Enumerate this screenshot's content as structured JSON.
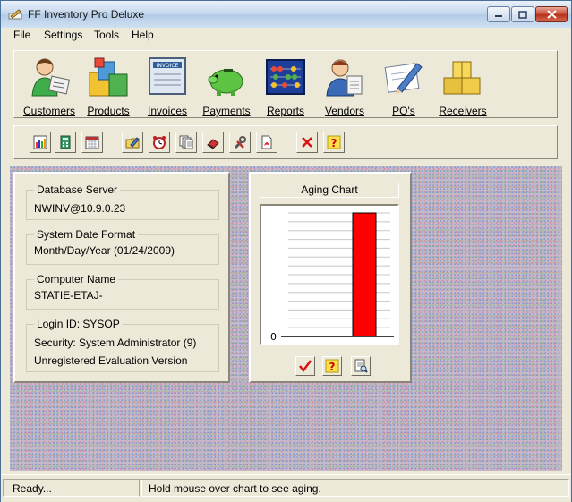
{
  "window": {
    "title": "FF Inventory Pro Deluxe",
    "icon": "app-pencil-icon"
  },
  "menu": [
    "File",
    "Settings",
    "Tools",
    "Help"
  ],
  "main_toolbar": [
    {
      "label": "Customers",
      "icon": "customers-icon"
    },
    {
      "label": "Products",
      "icon": "products-icon"
    },
    {
      "label": "Invoices",
      "icon": "invoices-icon"
    },
    {
      "label": "Payments",
      "icon": "piggy-bank-icon"
    },
    {
      "label": "Reports",
      "icon": "abacus-icon"
    },
    {
      "label": "Vendors",
      "icon": "vendors-icon"
    },
    {
      "label": "PO's",
      "icon": "po-pen-icon"
    },
    {
      "label": "Receivers",
      "icon": "boxes-icon"
    }
  ],
  "small_toolbar": [
    "chart-report-icon",
    "calculator-icon",
    "calendar-icon",
    "edit-folder-icon",
    "alarm-clock-icon",
    "documents-icon",
    "eraser-icon",
    "tools-icon",
    "pdf-icon",
    "close-x-icon",
    "help-icon"
  ],
  "info": {
    "db_label": "Database Server",
    "db_value": "NWINV@10.9.0.23",
    "date_label": "System Date Format",
    "date_value": "Month/Day/Year (01/24/2009)",
    "computer_label": "Computer Name",
    "computer_value": "STATIE-ETAJ-",
    "login": "Login ID: SYSOP",
    "security": "Security: System Administrator (9)",
    "version": "Unregistered Evaluation Version"
  },
  "chart": {
    "title": "Aging Chart",
    "zero_label": "0",
    "bar_color": "#ff0000"
  },
  "chart_data": {
    "type": "bar",
    "categories": [
      ""
    ],
    "values": [
      1
    ],
    "ylim": [
      0,
      1.0
    ],
    "grid": true,
    "legend": "none"
  },
  "chart_buttons": [
    "checkmark-icon",
    "help-icon",
    "print-preview-icon"
  ],
  "status": {
    "left": "Ready...",
    "right": "Hold mouse over chart to see aging."
  }
}
